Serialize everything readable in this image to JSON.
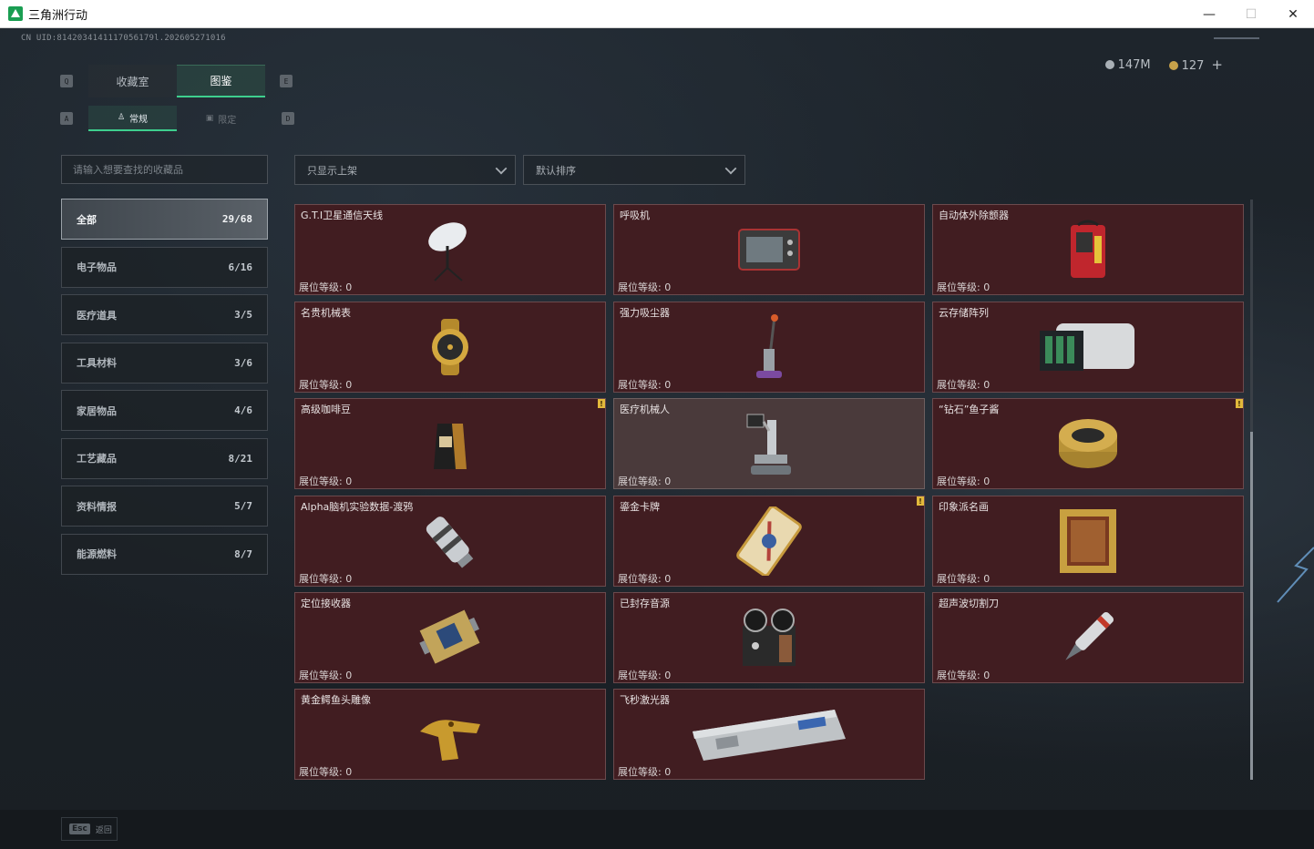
{
  "window": {
    "title": "三角洲行动",
    "minimize": "—",
    "maximize": "☐",
    "close": "✕"
  },
  "header": {
    "uid": "CN UID:8142034141117056179l.202605271016",
    "silver_amount": "147M",
    "gold_amount": "127",
    "gold_plus": "+"
  },
  "tabs": {
    "left_key": "Q",
    "right_key": "E",
    "items": [
      {
        "label": "收藏室",
        "active": false
      },
      {
        "label": "图鉴",
        "active": true
      }
    ]
  },
  "subtabs": {
    "left_key": "A",
    "right_key": "D",
    "items": [
      {
        "label": "常规",
        "icon": "figure-icon",
        "active": true
      },
      {
        "label": "限定",
        "icon": "card-icon",
        "active": false
      }
    ]
  },
  "search": {
    "placeholder": "请输入想要查找的收藏品",
    "value": ""
  },
  "filters": {
    "show_filter": "只显示上架",
    "sort": "默认排序"
  },
  "categories": [
    {
      "label": "全部",
      "count": "29/68",
      "active": true
    },
    {
      "label": "电子物品",
      "count": "6/16",
      "active": false
    },
    {
      "label": "医疗道具",
      "count": "3/5",
      "active": false
    },
    {
      "label": "工具材料",
      "count": "3/6",
      "active": false
    },
    {
      "label": "家居物品",
      "count": "4/6",
      "active": false
    },
    {
      "label": "工艺藏品",
      "count": "8/21",
      "active": false
    },
    {
      "label": "资料情报",
      "count": "5/7",
      "active": false
    },
    {
      "label": "能源燃料",
      "count": "8/7",
      "active": false
    }
  ],
  "items": [
    {
      "name": "G.T.I卫星通信天线",
      "level": "展位等级: 0",
      "icon": "satellite-dish-icon",
      "new": false,
      "dim": false
    },
    {
      "name": "呼吸机",
      "level": "展位等级: 0",
      "icon": "ventilator-icon",
      "new": false,
      "dim": false
    },
    {
      "name": "自动体外除颤器",
      "level": "展位等级: 0",
      "icon": "defibrillator-icon",
      "new": false,
      "dim": false
    },
    {
      "name": "名贵机械表",
      "level": "展位等级: 0",
      "icon": "watch-icon",
      "new": false,
      "dim": false
    },
    {
      "name": "强力吸尘器",
      "level": "展位等级: 0",
      "icon": "vacuum-icon",
      "new": false,
      "dim": false
    },
    {
      "name": "云存储阵列",
      "level": "展位等级: 0",
      "icon": "storage-array-icon",
      "new": false,
      "dim": false
    },
    {
      "name": "高级咖啡豆",
      "level": "展位等级: 0",
      "icon": "coffee-bag-icon",
      "new": true,
      "dim": false
    },
    {
      "name": "医疗机械人",
      "level": "展位等级: 0",
      "icon": "medical-robot-icon",
      "new": false,
      "dim": true
    },
    {
      "name": "“钻石”鱼子酱",
      "level": "展位等级: 0",
      "icon": "caviar-tin-icon",
      "new": true,
      "dim": false
    },
    {
      "name": "Alpha脑机实验数据-渡鸦",
      "level": "展位等级: 0",
      "icon": "data-canister-icon",
      "new": false,
      "dim": false
    },
    {
      "name": "鎏金卡牌",
      "level": "展位等级: 0",
      "icon": "gilded-card-icon",
      "new": true,
      "dim": false
    },
    {
      "name": "印象派名画",
      "level": "展位等级: 0",
      "icon": "painting-icon",
      "new": false,
      "dim": false
    },
    {
      "name": "定位接收器",
      "level": "展位等级: 0",
      "icon": "gps-receiver-icon",
      "new": false,
      "dim": false
    },
    {
      "name": "已封存音源",
      "level": "展位等级: 0",
      "icon": "tape-recorder-icon",
      "new": false,
      "dim": false
    },
    {
      "name": "超声波切割刀",
      "level": "展位等级: 0",
      "icon": "ultrasonic-cutter-icon",
      "new": false,
      "dim": false
    },
    {
      "name": "黄金鳄鱼头雕像",
      "level": "展位等级: 0",
      "icon": "gold-crocodile-icon",
      "new": false,
      "dim": false
    },
    {
      "name": "飞秒激光器",
      "level": "展位等级: 0",
      "icon": "laser-device-icon",
      "new": false,
      "dim": false
    }
  ],
  "footer": {
    "esc_key": "Esc",
    "esc_label": "返回"
  },
  "colors": {
    "accent": "#3ecf8e",
    "card_bg": "#411d21",
    "card_border": "#6b4a4d",
    "new_badge": "#e2b93b"
  }
}
